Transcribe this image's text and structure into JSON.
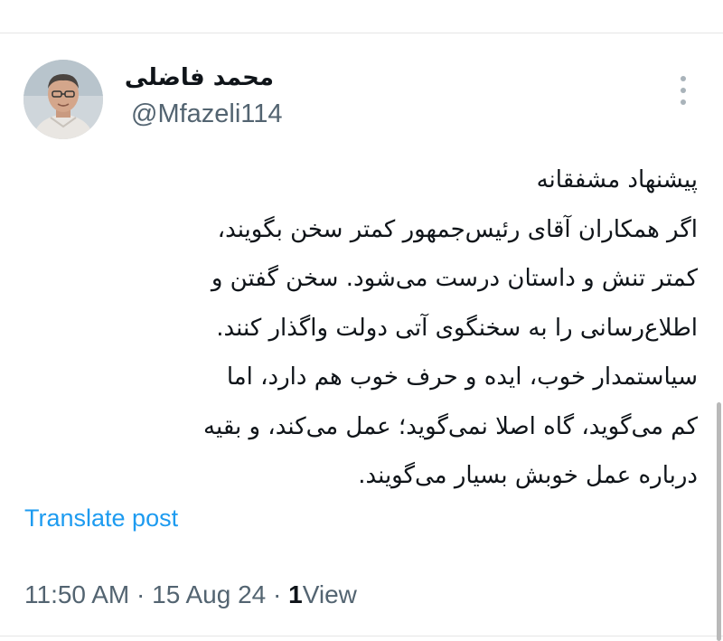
{
  "author": {
    "name": "محمد فاضلی",
    "handle": "@Mfazeli114",
    "avatar_icon": "profile-photo"
  },
  "post": {
    "lines": [
      "پیشنهاد مشفقانه",
      "اگر همکاران آقای رئیس‌جمهور کمتر سخن بگویند،",
      "کمتر تنش و داستان درست می‌شود.  سخن گفتن و",
      "اطلاع‌رسانی را به سخنگوی آتی دولت واگذار  کنند.",
      "سیاستمدار خوب، ایده و حرف خوب هم دارد، اما",
      "کم می‌گوید، گاه اصلا  نمی‌گوید؛ عمل می‌کند، و بقیه",
      "درباره عمل خوبش بسیار می‌گویند."
    ]
  },
  "translate_label": "Translate post",
  "meta": {
    "time": "11:50 AM",
    "separator": "·",
    "date": "15 Aug 24",
    "views_count": "1",
    "views_label": "View"
  },
  "colors": {
    "link": "#1d9bf0",
    "secondary_text": "#536471",
    "primary_text": "#0f1419"
  }
}
